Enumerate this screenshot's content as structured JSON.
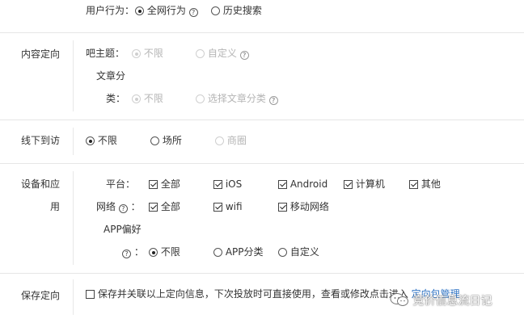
{
  "user_behavior": {
    "label": "用户行为：",
    "options": [
      {
        "label": "全网行为",
        "checked": true,
        "has_help": true
      },
      {
        "label": "历史搜索",
        "checked": false
      }
    ]
  },
  "content_targeting": {
    "section_label": "内容定向",
    "forum_topic_label": "吧主题：",
    "forum_topic_options": [
      "不限",
      "自定义"
    ],
    "article_label_line1": "文章分",
    "article_label_line2": "类：",
    "article_options": [
      "不限",
      "选择文章分类"
    ]
  },
  "offline_visit": {
    "section_label": "线下到访",
    "options": [
      "不限",
      "场所",
      "商圈"
    ]
  },
  "device_app": {
    "section_label_line1": "设备和应",
    "section_label_line2": "用",
    "platform_label": "平台：",
    "platform_options": [
      "全部",
      "iOS",
      "Android",
      "计算机",
      "其他"
    ],
    "network_label": "网络",
    "network_colon": "：",
    "network_options": [
      "全部",
      "wifi",
      "移动网络"
    ],
    "app_pref_label": "APP偏好",
    "app_pref_colon": "：",
    "app_pref_options": [
      "不限",
      "APP分类",
      "自定义"
    ]
  },
  "save_targeting": {
    "section_label": "保存定向",
    "checkbox_text": "保存并关联以上定向信息，下次投放时可直接使用，查看或修改点击进入",
    "link_text": "定向包管理"
  },
  "icons": {
    "help": "help-circle-icon",
    "watermark": "wechat-icon"
  },
  "watermark": {
    "text": "竞价信息流日记"
  }
}
